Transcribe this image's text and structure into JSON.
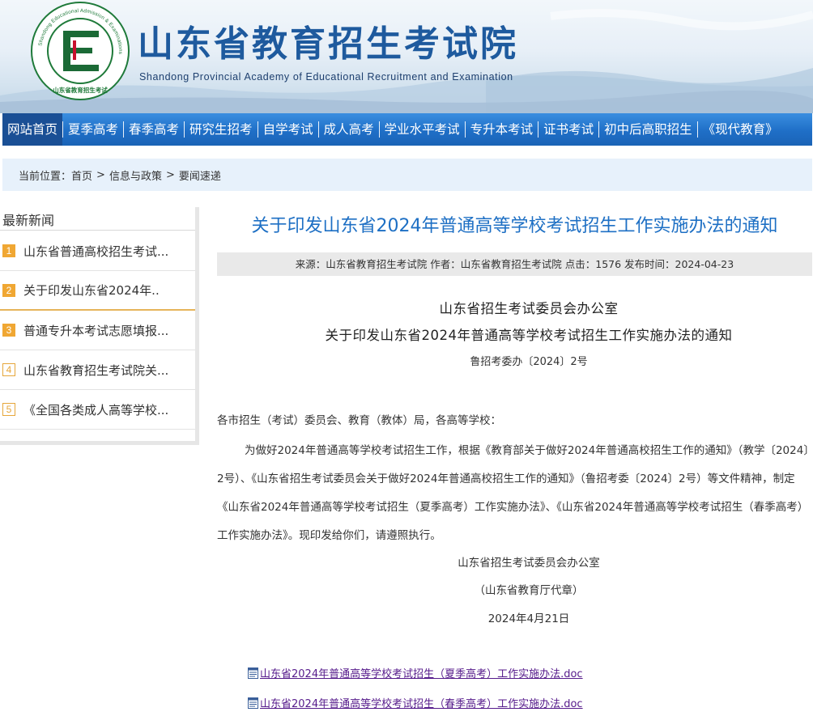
{
  "header": {
    "title": "山东省教育招生考试院",
    "subtitle": "Shandong Provincial Academy of Educational Recruitment and Examination",
    "logo": {
      "ring_text": "Shandong Educational Admission & Examinations",
      "cn_text": "山东省教育招生考试",
      "colors": {
        "ring": "#1f7a3a",
        "letter": "#1b6a36",
        "accent": "#c8102e"
      }
    }
  },
  "nav": {
    "items": [
      {
        "label": "网站首页",
        "active": true
      },
      {
        "label": "夏季高考"
      },
      {
        "label": "春季高考"
      },
      {
        "label": "研究生招考"
      },
      {
        "label": "自学考试"
      },
      {
        "label": "成人高考"
      },
      {
        "label": "学业水平考试"
      },
      {
        "label": "专升本考试"
      },
      {
        "label": "证书考试"
      },
      {
        "label": "初中后高职招生"
      },
      {
        "label": "《现代教育》"
      }
    ]
  },
  "breadcrumb": {
    "prefix": "当前位置：",
    "items": [
      "首页",
      "信息与政策",
      "要闻速递"
    ],
    "separator": ">"
  },
  "sidebar": {
    "heading": "最新新闻",
    "items": [
      {
        "num": "1",
        "title": "山东省普通高校招生考试..."
      },
      {
        "num": "2",
        "title": "关于印发山东省2024年.."
      },
      {
        "num": "3",
        "title": "普通专升本考试志愿填报..."
      },
      {
        "num": "4",
        "title": "山东省教育招生考试院关..."
      },
      {
        "num": "5",
        "title": "《全国各类成人高等学校..."
      }
    ]
  },
  "article": {
    "title": "关于印发山东省2024年普通高等学校考试招生工作实施办法的通知",
    "meta": "来源：山东省教育招生考试院 作者：山东省教育招生考试院 点击：1576 发布时间：2024-04-23",
    "issuer": "山东省招生考试委员会办公室",
    "doc_title": "关于印发山东省2024年普通高等学校考试招生工作实施办法的通知",
    "doc_number": "鲁招考委办〔2024〕2号",
    "addressee": "各市招生（考试）委员会、教育（教体）局，各高等学校：",
    "paragraph": "为做好2024年普通高等学校考试招生工作，根据《教育部关于做好2024年普通高校招生工作的通知》（教学〔2024〕2号）、《山东省招生考试委员会关于做好2024年普通高校招生工作的通知》（鲁招考委〔2024〕2号）等文件精神，制定《山东省2024年普通高等学校考试招生（夏季高考）工作实施办法》、《山东省2024年普通高等学校考试招生（春季高考）工作实施办法》。现印发给你们，请遵照执行。",
    "signature": "山东省招生考试委员会办公室",
    "seal_note": "（山东省教育厅代章）",
    "date": "2024年4月21日",
    "attachments": [
      "山东省2024年普通高等学校考试招生（夏季高考）工作实施办法.doc",
      "山东省2024年普通高等学校考试招生（春季高考）工作实施办法.doc"
    ]
  },
  "colors": {
    "nav_bg": "#1f6fc7",
    "nav_active": "#1a4f95",
    "title_blue": "#1d6fc4",
    "badge_orange": "#f0a733",
    "visited_link": "#551a8b"
  }
}
